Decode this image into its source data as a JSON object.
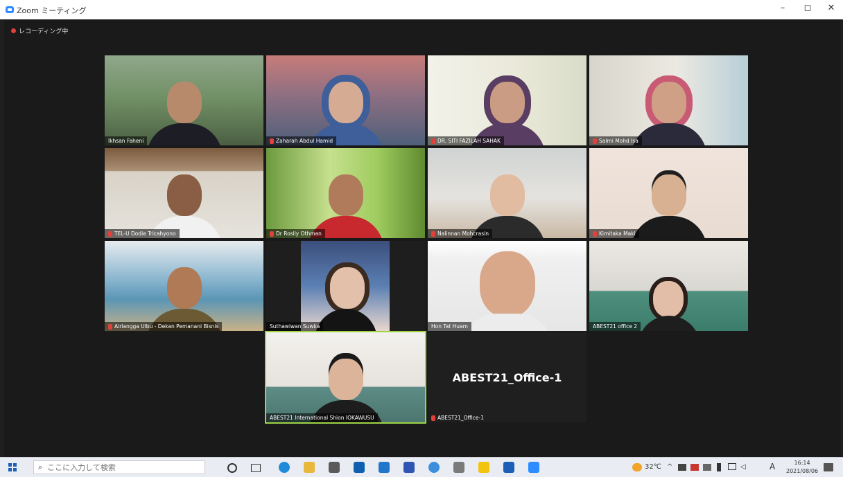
{
  "window": {
    "title": "Zoom ミーティング",
    "minimize": "–",
    "maximize": "◻",
    "close": "✕"
  },
  "recording": {
    "label": "レコーディング中"
  },
  "participants": [
    {
      "name": "Ikhsan Faheni"
    },
    {
      "name": "Zaharah Abdul Hamid"
    },
    {
      "name": "DR. SITI FAZILAH SAHAK"
    },
    {
      "name": "Salmi Mohd Isa"
    },
    {
      "name": "TEL-U Dodie Tricahyono"
    },
    {
      "name": "Dr Roslly Othman"
    },
    {
      "name": "Nalinnan Mohcrasin"
    },
    {
      "name": "Kimitaka Maki"
    },
    {
      "name": "Airlangga Ulbu - Dekan Pemanani Bisnis"
    },
    {
      "name": "Suthawiwan Suwka"
    },
    {
      "name": "Hon Tat Huam"
    },
    {
      "name": "ABEST21 office 2"
    },
    {
      "name": "ABEST21 International Shion IOKAWUSU"
    },
    {
      "name": "ABEST21_Office-1",
      "big_label": "ABEST21_Office-1"
    }
  ],
  "taskbar": {
    "search_placeholder": "ここに入力して検索",
    "weather": "32℃",
    "ime": "A",
    "time": "16:14",
    "date": "2021/08/06"
  }
}
